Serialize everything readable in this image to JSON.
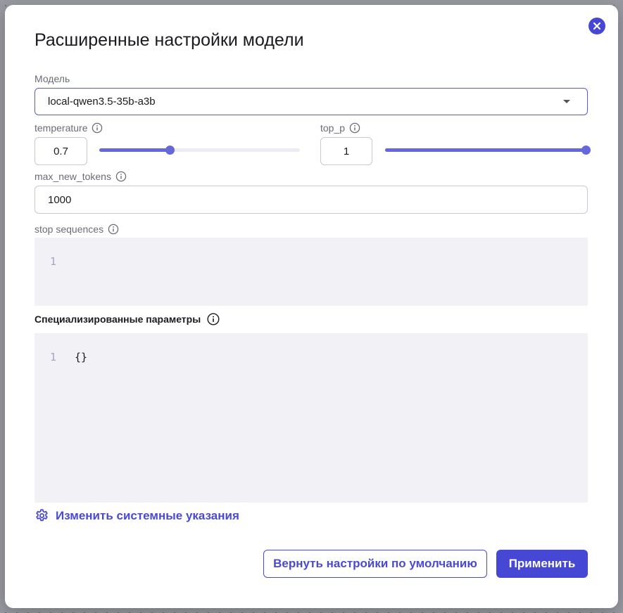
{
  "dialog": {
    "title": "Расширенные настройки модели",
    "close_icon": "close-icon"
  },
  "model": {
    "label": "Модель",
    "selected": "local-qwen3.5-35b-a3b"
  },
  "temperature": {
    "label": "temperature",
    "value": "0.7",
    "slider_fraction": 0.35
  },
  "top_p": {
    "label": "top_p",
    "value": "1",
    "slider_fraction": 1.0
  },
  "max_new_tokens": {
    "label": "max_new_tokens",
    "value": "1000"
  },
  "stop_sequences": {
    "label": "stop sequences",
    "line_number": "1",
    "content": ""
  },
  "specialized": {
    "label": "Специализированные параметры",
    "line_number": "1",
    "content": "{}"
  },
  "system_link": {
    "label": "Изменить системные указания",
    "icon": "gear-icon"
  },
  "buttons": {
    "reset": "Вернуть настройки по умолчанию",
    "apply": "Применить"
  },
  "colors": {
    "accent": "#4747d6",
    "slider_fill": "#6767dc",
    "slider_track": "#ebebf7",
    "code_bg": "#f1f1f6"
  }
}
